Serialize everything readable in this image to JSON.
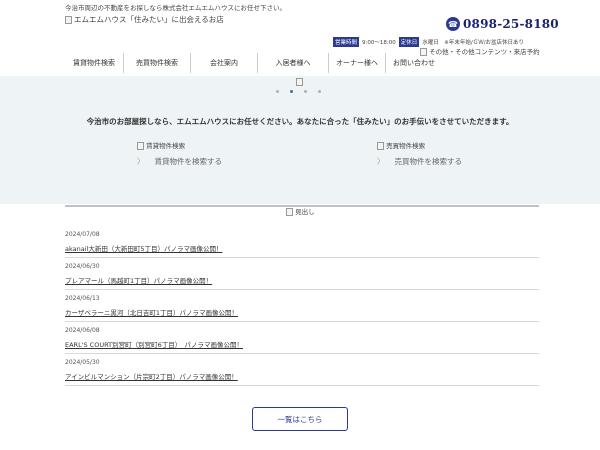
{
  "header": {
    "tagline": "今治市周辺の不動産をお探しなら株式会社エムエムハウスにお任せ下さい。",
    "logo_alt": "エムエムハウス「住みたい」に出会えるお店",
    "phone": "0898-25-8180",
    "hours_label": "営業時間",
    "hours_value": "9:00～18:00",
    "closed_label": "定休日",
    "closed_value": "水曜日　※年末年始/ＧＷ/お盆店休日あり",
    "extra_alt": "その他・その他コンテンツ・来店予約"
  },
  "nav": {
    "items": [
      "賃貸物件検索",
      "売買物件検索",
      "会社案内",
      "入居者様へ",
      "オーナー様へ",
      "お問い合わせ"
    ]
  },
  "hero": {
    "intro": "今治市のお部屋探しなら、エムエムハウスにお任せください。あなたに合った「住みたい」のお手伝いをさせていただきます。",
    "rent_alt": "賃貸物件検索",
    "rent_link": "賃貸物件を検索する",
    "sale_alt": "売買物件検索",
    "sale_link": "売買物件を検索する"
  },
  "news": {
    "heading_alt": "見出し",
    "items": [
      {
        "date": "2024/07/08",
        "title": "akanail大新田（大新田町5丁目）パノラマ画像公開！"
      },
      {
        "date": "2024/06/30",
        "title": "プレアマール（馬越町1丁目）パノラマ画像公開！"
      },
      {
        "date": "2024/06/13",
        "title": "カーザベラーニ黒河（北日吉町1丁目）パノラマ画像公開！"
      },
      {
        "date": "2024/06/08",
        "title": "EARL'S COURT別宮町（別宮町6丁目）　パノラマ画像公開！"
      },
      {
        "date": "2024/05/30",
        "title": "アインビルマンション（片宗町2丁目）パノラマ画像公開！"
      }
    ],
    "more_label": "一覧はこちら"
  },
  "colors": {
    "accent": "#2b3a8f",
    "hero_bg": "#eef3f6"
  }
}
